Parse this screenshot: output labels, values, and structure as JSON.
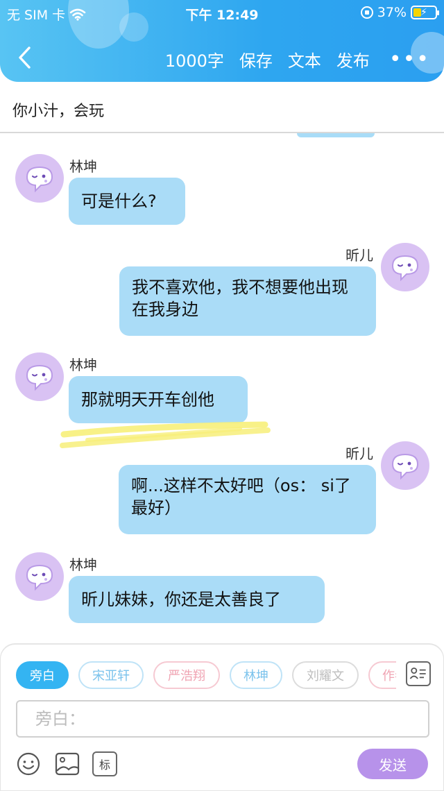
{
  "status_bar": {
    "carrier": "无 SIM 卡",
    "time": "下午 12:49",
    "battery": "37%",
    "battery_level": 0.37
  },
  "nav": {
    "word_count": "1000字",
    "save": "保存",
    "text": "文本",
    "publish": "发布"
  },
  "title": "你小汁，会玩",
  "messages": [
    {
      "name": "林坤",
      "text": "可是什么?",
      "side": "left"
    },
    {
      "name": "昕儿",
      "text": "我不喜欢他，我不想要他出现在我身边",
      "side": "right"
    },
    {
      "name": "林坤",
      "text": "那就明天开车创他",
      "side": "left"
    },
    {
      "name": "昕儿",
      "text": "啊...这样不太好吧（os： si了最好）",
      "side": "right"
    },
    {
      "name": "林坤",
      "text": "昕儿妹妹，你还是太善良了",
      "side": "left"
    }
  ],
  "roles": [
    "旁白",
    "宋亚轩",
    "严浩翔",
    "林坤",
    "刘耀文",
    "作者"
  ],
  "input": {
    "placeholder": "旁白："
  },
  "toolbar": {
    "tag_label": "标",
    "send_label": "发送"
  },
  "colors": {
    "header": "#2ea6f0",
    "bubble": "#aadcf7",
    "avatar": "#d9c2f3",
    "send": "#b792ea",
    "active_role": "#34b4f2",
    "highlighter": "#f7ef7a"
  },
  "icons": [
    "back-icon",
    "more-icon",
    "wifi-icon",
    "lock-icon",
    "battery-icon",
    "avatar-icon",
    "contact-card-icon",
    "emoji-icon",
    "image-icon",
    "tag-icon"
  ]
}
